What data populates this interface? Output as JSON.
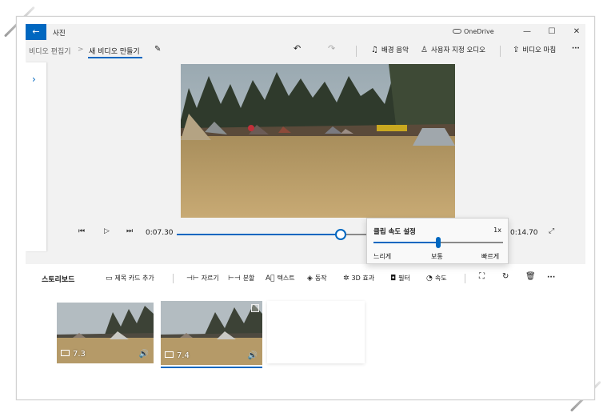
{
  "titlebar": {
    "back_icon": "arrow-left-icon",
    "app_title": "사진",
    "onedrive_label": "OneDrive",
    "minimize_glyph": "—",
    "maximize_glyph": "☐",
    "close_glyph": "✕"
  },
  "breadcrumb": {
    "parent": "비디오 편집기",
    "separator": ">",
    "current": "새 비디오 만들기"
  },
  "commands": {
    "background_music": "배경 음악",
    "custom_audio": "사용자 지정 오디오",
    "finish_video": "비디오 마침",
    "more": "···"
  },
  "player": {
    "current_time": "0:07.30",
    "total_time": "0:14.70",
    "progress": 0.54
  },
  "speed_popup": {
    "title": "클립 속도 설정",
    "value": "1x",
    "slow_label": "느리게",
    "normal_label": "보통",
    "fast_label": "빠르게",
    "level": 0.5
  },
  "storyboard": {
    "title": "스토리보드",
    "tools": {
      "add_title_card": "제목 카드 추가",
      "trim": "자르기",
      "split": "분할",
      "text": "텍스트",
      "motion": "동작",
      "effects_3d": "3D 효과",
      "filters": "필터",
      "speed": "속도"
    },
    "more": "···",
    "clips": [
      {
        "duration": "7.3",
        "selected": false
      },
      {
        "duration": "7.4",
        "selected": true
      }
    ]
  },
  "colors": {
    "accent": "#0067c0",
    "chrome": "#f2f2f2"
  }
}
